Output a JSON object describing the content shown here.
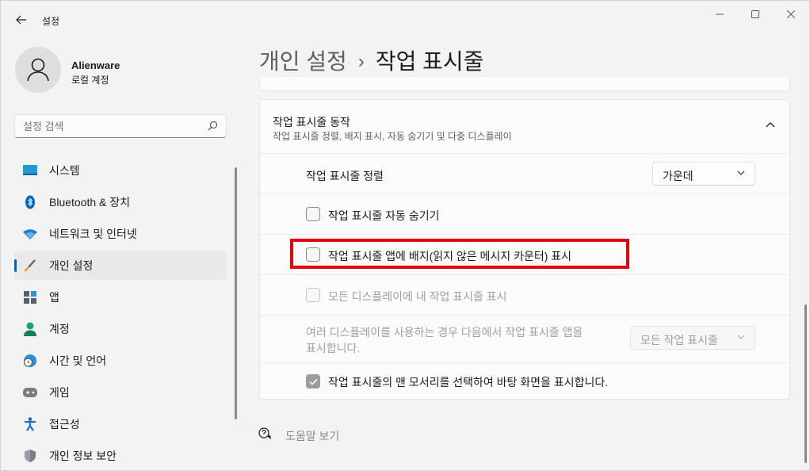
{
  "window": {
    "app_title": "설정",
    "controls": {
      "minimize": "minimize-icon",
      "maximize": "maximize-icon",
      "close": "close-icon"
    }
  },
  "user": {
    "name": "Alienware",
    "account": "로컬 계정"
  },
  "search": {
    "placeholder": "설정 검색"
  },
  "sidebar": {
    "items": [
      {
        "label": "시스템",
        "icon": "system-icon"
      },
      {
        "label": "Bluetooth & 장치",
        "icon": "bluetooth-icon"
      },
      {
        "label": "네트워크 및 인터넷",
        "icon": "wifi-icon"
      },
      {
        "label": "개인 설정",
        "icon": "brush-icon",
        "active": true
      },
      {
        "label": "앱",
        "icon": "apps-icon"
      },
      {
        "label": "계정",
        "icon": "account-icon"
      },
      {
        "label": "시간 및 언어",
        "icon": "time-language-icon"
      },
      {
        "label": "게임",
        "icon": "gamepad-icon"
      },
      {
        "label": "접근성",
        "icon": "accessibility-icon"
      },
      {
        "label": "개인 정보 보안",
        "icon": "shield-icon"
      }
    ]
  },
  "breadcrumb": {
    "parent": "개인 설정",
    "separator": "›",
    "current": "작업 표시줄"
  },
  "section": {
    "title": "작업 표시줄 동작",
    "subtitle": "작업 표시줄 정렬, 배지 표시, 자동 숨기기 및 다중 디스플레이",
    "alignment": {
      "label": "작업 표시줄 정렬",
      "value": "가운데"
    },
    "auto_hide": {
      "label": "작업 표시줄 자동 숨기기",
      "checked": false
    },
    "badges": {
      "label": "작업 표시줄 앱에 배지(읽지 않은 메시지 카운터) 표시",
      "checked": false
    },
    "all_displays": {
      "label": "모든 디스플레이에 내 작업 표시줄 표시",
      "checked": false,
      "disabled": true
    },
    "multi_display": {
      "label_line1": "여러 디스플레이를 사용하는 경우 다음에서 작업 표시줄 앱을",
      "label_line2": "표시합니다.",
      "value": "모든 작업 표시줄",
      "disabled": true
    },
    "show_desktop": {
      "label": "작업 표시줄의 맨 모서리를 선택하여 바탕 화면을 표시합니다.",
      "checked": true
    }
  },
  "help": {
    "label": "도움말 보기"
  },
  "colors": {
    "accent": "#0067c0",
    "highlight": "#e8000a"
  }
}
